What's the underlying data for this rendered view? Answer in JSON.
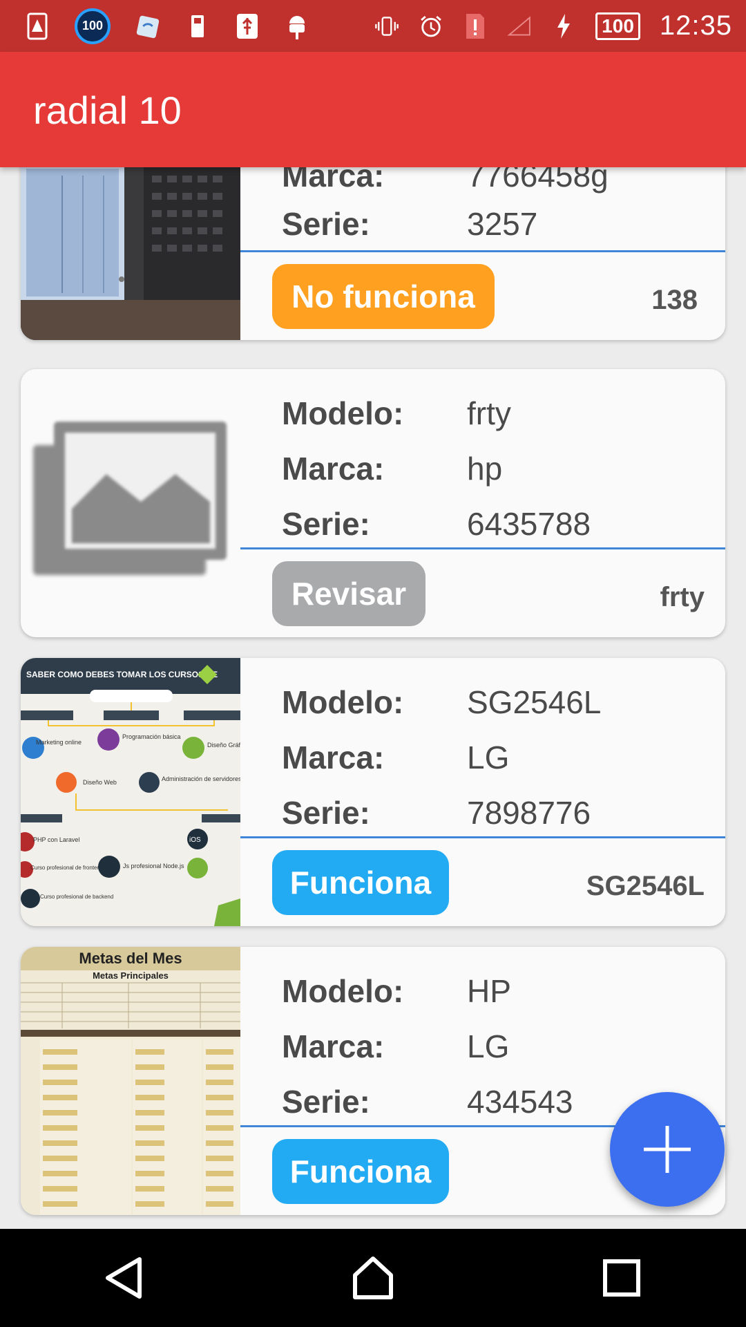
{
  "status_bar": {
    "time": "12:35",
    "badge": "100",
    "battery": "100"
  },
  "app_bar": {
    "title": "radial 10"
  },
  "cards": [
    {
      "rows": [
        {
          "label": "Marca:",
          "value": "7766458g"
        },
        {
          "label": "Serie:",
          "value": "3257"
        }
      ],
      "status": "No funciona",
      "status_color": "#ffa020",
      "right_value": "138",
      "thumb": "photo-laptop-screen"
    },
    {
      "rows": [
        {
          "label": "Modelo:",
          "value": "frty"
        },
        {
          "label": "Marca:",
          "value": "hp"
        },
        {
          "label": "Serie:",
          "value": "6435788"
        }
      ],
      "status": "Revisar",
      "status_color": "#a9aaac",
      "right_value": "frty",
      "thumb": "image-placeholder-icon"
    },
    {
      "rows": [
        {
          "label": "Modelo:",
          "value": "SG2546L"
        },
        {
          "label": "Marca:",
          "value": "LG"
        },
        {
          "label": "Serie:",
          "value": "7898776"
        }
      ],
      "status": "Funciona",
      "status_color": "#22aaf2",
      "right_value": "SG2546L",
      "thumb": "infographic-courses",
      "thumb_text": {
        "header": "SABER COMO DEBES TOMAR LOS CURSOS DE",
        "nodes": [
          "Marketing online",
          "Programación básica",
          "Diseño Gráfico",
          "Diseño Web",
          "Administración de servidores",
          "PHP con Laravel",
          "Curso profesional de frontend",
          "Js profesional Node.js",
          "Curso profesional de backend"
        ]
      }
    },
    {
      "rows": [
        {
          "label": "Modelo:",
          "value": "HP"
        },
        {
          "label": "Marca:",
          "value": "LG"
        },
        {
          "label": "Serie:",
          "value": "434543"
        }
      ],
      "status": "Funciona",
      "status_color": "#22aaf2",
      "right_value": "",
      "thumb": "spreadsheet-goals",
      "thumb_text": {
        "title": "Metas del Mes",
        "subtitle": "Metas Principales"
      }
    }
  ],
  "fab": {
    "icon": "plus-icon"
  },
  "nav": {
    "back": "back-icon",
    "home": "home-icon",
    "recents": "recents-icon"
  }
}
